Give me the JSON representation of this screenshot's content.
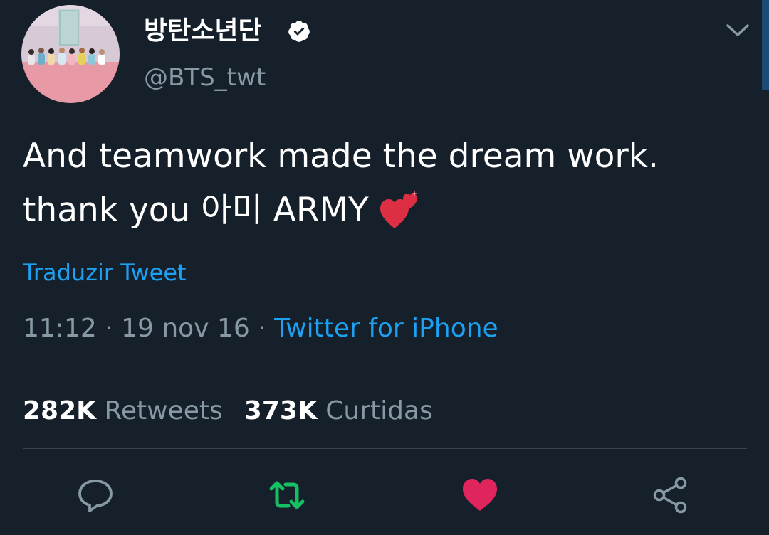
{
  "user": {
    "display_name": "방탄소년단",
    "handle": "@BTS_twt",
    "verified": true,
    "verified_icon": "verified-badge-icon"
  },
  "tweet": {
    "text_line1": "And teamwork made the dream work.",
    "text_line2": "thank you 아미 ARMY",
    "emoji": "two-hearts-emoji",
    "translate_label": "Traduzir Tweet",
    "time": "11:12",
    "date": "19 nov 16",
    "separator": "·",
    "source": "Twitter for iPhone"
  },
  "stats": {
    "retweets_count": "282K",
    "retweets_label": "Retweets",
    "likes_count": "373K",
    "likes_label": "Curtidas"
  },
  "actions": {
    "reply_icon": "reply-icon",
    "retweet_icon": "retweet-icon",
    "like_icon": "heart-icon",
    "share_icon": "share-icon"
  },
  "colors": {
    "background": "#15202b",
    "text": "#ffffff",
    "secondary_text": "#8899a6",
    "link": "#1da1f2",
    "divider": "#38444d",
    "retweet_active": "#17bf63",
    "like_active": "#e0245e"
  }
}
